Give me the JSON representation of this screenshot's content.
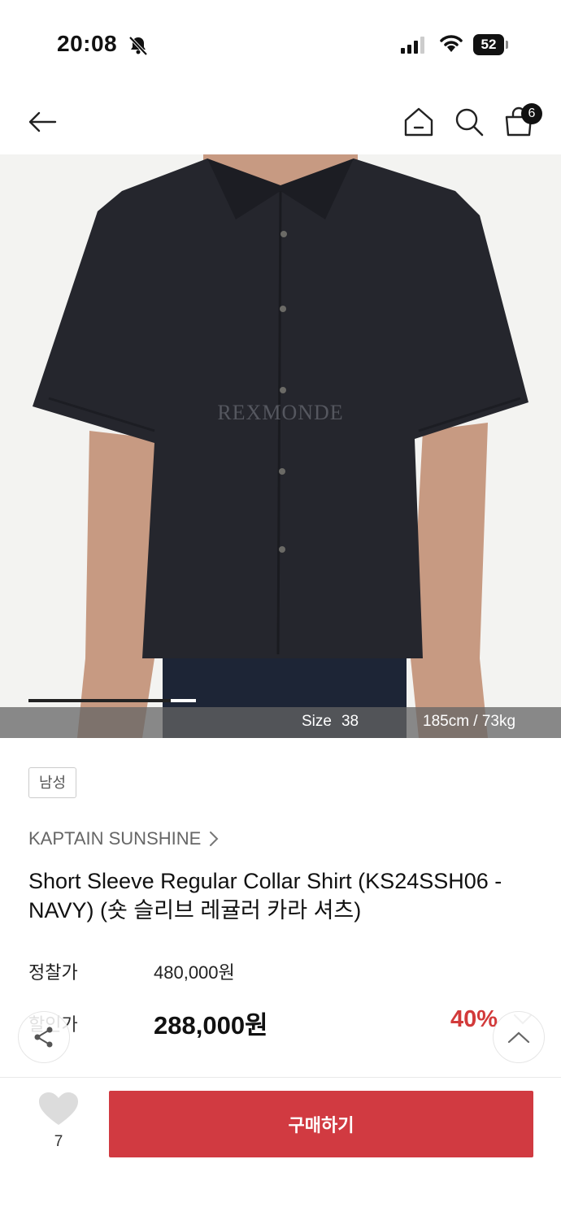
{
  "status_bar": {
    "time": "20:08",
    "battery": "52"
  },
  "nav": {
    "cart_count": "6",
    "icons": [
      "back-arrow-icon",
      "home-icon",
      "search-icon",
      "shopping-bag-icon"
    ]
  },
  "image": {
    "watermark": "REXMONDE",
    "carousel_progress": 0.85,
    "model_size_label": "Size",
    "model_size_value": "38",
    "model_body": "185cm / 73kg",
    "colors": {
      "shirt": "#25262d",
      "jeans": "#1d2536",
      "skin": "#c79a82"
    }
  },
  "product": {
    "gender_tag": "남성",
    "brand": "KAPTAIN SUNSHINE",
    "title": "Short Sleeve Regular Collar Shirt (KS24SSH06 - NAVY) (숏 슬리브 레귤러 카라 셔츠)",
    "regular_price_label": "정찰가",
    "regular_price": "480,000원",
    "sale_price_label": "할인가",
    "sale_price": "288,000원",
    "discount": "40%"
  },
  "actions": {
    "like_count": "7",
    "buy_label": "구매하기",
    "accent": "#d13a41"
  }
}
